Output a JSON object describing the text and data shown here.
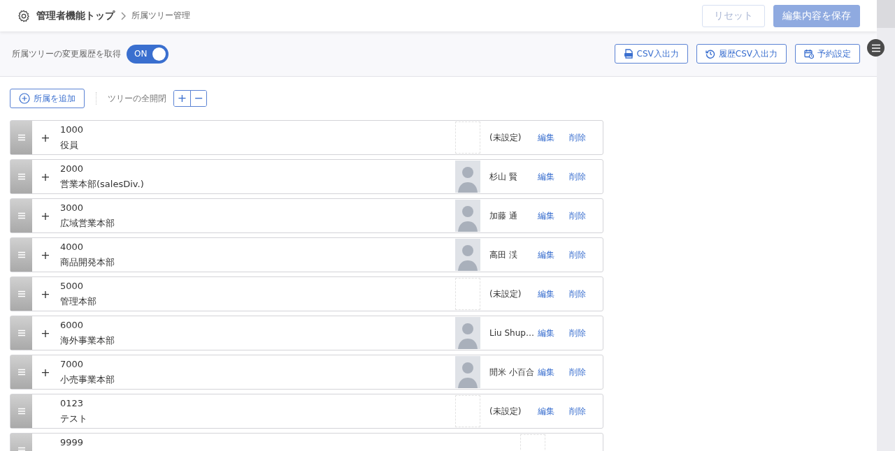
{
  "header": {
    "title": "管理者機能トップ",
    "breadcrumb": "所属ツリー管理",
    "buttons": [
      {
        "label": "リセット",
        "kind": "secondary",
        "disabled": true
      },
      {
        "label": "編集内容を保存",
        "kind": "primary",
        "disabled": true
      }
    ]
  },
  "history_toggle": {
    "label": "所属ツリーの変更履歴を取得",
    "on": true,
    "text": "ON"
  },
  "toolbar_buttons": [
    {
      "label": "CSV入出力",
      "kind": "csv"
    },
    {
      "label": "履歴CSV入出力",
      "kind": "history"
    },
    {
      "label": "予約設定",
      "kind": "schedule"
    }
  ],
  "add_button": {
    "label": "所属を追加"
  },
  "expand_all": {
    "label": "ツリーの全開閉",
    "expand": "+",
    "collapse": "−"
  },
  "rows": [
    {
      "code": "1000",
      "name": "役員",
      "expand": "+",
      "photo": false,
      "manager": "(未設定)",
      "edit": "編集",
      "delete": "削除"
    },
    {
      "code": "2000",
      "name": "営業本部(salesDiv.)",
      "expand": "+",
      "photo": true,
      "manager": "杉山 賢",
      "edit": "編集",
      "delete": "削除"
    },
    {
      "code": "3000",
      "name": "広域営業本部",
      "expand": "+",
      "photo": true,
      "manager": "加藤 通",
      "edit": "編集",
      "delete": "削除"
    },
    {
      "code": "4000",
      "name": "商品開発本部",
      "expand": "+",
      "photo": true,
      "manager": "高田 渓",
      "edit": "編集",
      "delete": "削除"
    },
    {
      "code": "5000",
      "name": "管理本部",
      "expand": "+",
      "photo": false,
      "manager": "(未設定)",
      "edit": "編集",
      "delete": "削除"
    },
    {
      "code": "6000",
      "name": "海外事業本部",
      "expand": "+",
      "photo": true,
      "manager": "Liu Shup…",
      "edit": "編集",
      "delete": "削除"
    },
    {
      "code": "7000",
      "name": "小売事業本部",
      "expand": "+",
      "photo": true,
      "manager": "閒米 小百合",
      "edit": "編集",
      "delete": "削除"
    },
    {
      "code": "0123",
      "name": "テスト",
      "photo": false,
      "manager": "(未設定)",
      "edit": "編集",
      "delete": "削除"
    },
    {
      "code": "9999",
      "photo": false
    }
  ]
}
